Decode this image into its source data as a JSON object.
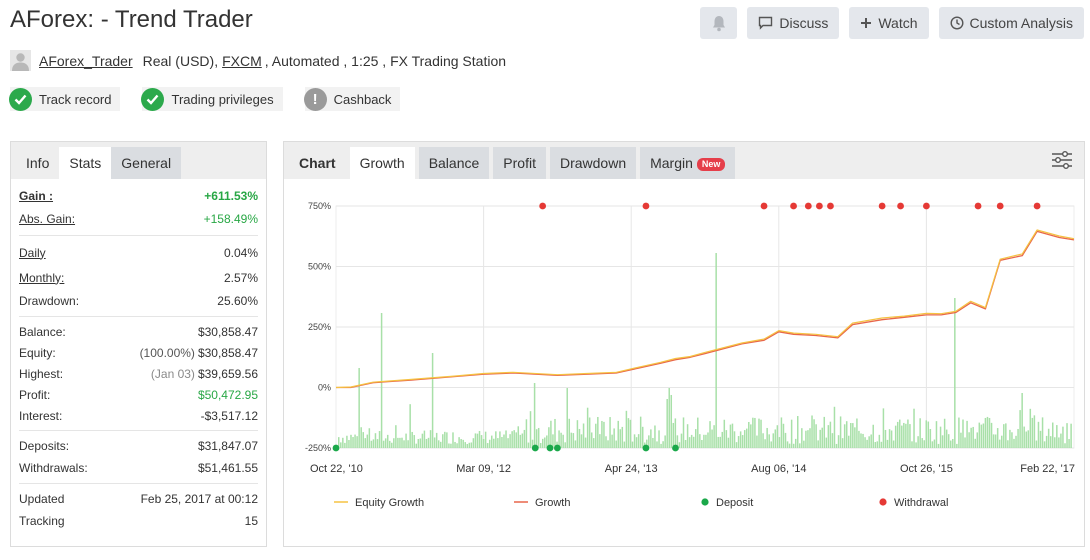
{
  "header": {
    "title": "AForex: - Trend Trader",
    "buttons": {
      "discuss": "Discuss",
      "watch": "Watch",
      "custom_analysis": "Custom Analysis"
    }
  },
  "account": {
    "trader": "AForex_Trader",
    "type": "Real (USD),",
    "broker": "FXCM",
    "details": ", Automated , 1:25 , FX Trading Station"
  },
  "badges": {
    "track_record": "Track record",
    "trading_privileges": "Trading privileges",
    "cashback": "Cashback"
  },
  "stats_tabs": {
    "info": "Info",
    "stats": "Stats",
    "general": "General"
  },
  "stats": {
    "gain": {
      "label": "Gain :",
      "value": "+611.53%"
    },
    "abs_gain": {
      "label": "Abs. Gain:",
      "value": "+158.49%"
    },
    "daily": {
      "label": "Daily",
      "value": "0.04%"
    },
    "monthly": {
      "label": "Monthly:",
      "value": "2.57%"
    },
    "drawdown": {
      "label": "Drawdown:",
      "value": "25.60%"
    },
    "balance": {
      "label": "Balance:",
      "value": "$30,858.47"
    },
    "equity": {
      "label": "Equity:",
      "note": "(100.00%)",
      "value": "$30,858.47"
    },
    "highest": {
      "label": "Highest:",
      "note": "(Jan 03)",
      "value": "$39,659.56"
    },
    "profit": {
      "label": "Profit:",
      "value": "$50,472.95"
    },
    "interest": {
      "label": "Interest:",
      "value": "-$3,517.12"
    },
    "deposits": {
      "label": "Deposits:",
      "value": "$31,847.07"
    },
    "withdrawals": {
      "label": "Withdrawals:",
      "value": "$51,461.55"
    },
    "updated": {
      "label": "Updated",
      "value": "Feb 25, 2017 at 00:12"
    },
    "tracking": {
      "label": "Tracking",
      "value": "15"
    }
  },
  "chart_tabs": {
    "chart": "Chart",
    "growth": "Growth",
    "balance": "Balance",
    "profit": "Profit",
    "drawdown": "Drawdown",
    "margin": "Margin",
    "new_badge": "New"
  },
  "colors": {
    "equity": "#f5c242",
    "growth": "#e8664a",
    "deposit": "#1aa84a",
    "withdrawal": "#e53935",
    "volume": "#a8e0a8"
  },
  "chart_data": {
    "type": "line",
    "yticks": [
      "750%",
      "500%",
      "250%",
      "0%",
      "-250%"
    ],
    "ytick_values": [
      750,
      500,
      250,
      0,
      -250
    ],
    "ylim": [
      -250,
      750
    ],
    "xticks": [
      "Oct 22, '10",
      "Mar 09, '12",
      "Apr 24, '13",
      "Aug 06, '14",
      "Oct 26, '15",
      "Feb 22, '17"
    ],
    "xlim": [
      0,
      1
    ],
    "legend": [
      "Equity Growth",
      "Growth",
      "Deposit",
      "Withdrawal"
    ],
    "legend_position": "bottom",
    "series": [
      {
        "name": "Growth",
        "x": [
          0,
          0.02,
          0.05,
          0.1,
          0.16,
          0.2,
          0.24,
          0.3,
          0.34,
          0.38,
          0.41,
          0.44,
          0.46,
          0.48,
          0.5,
          0.55,
          0.58,
          0.6,
          0.62,
          0.65,
          0.68,
          0.7,
          0.74,
          0.77,
          0.8,
          0.82,
          0.84,
          0.86,
          0.88,
          0.9,
          0.93,
          0.95,
          0.98,
          1.0
        ],
        "values": [
          0,
          0,
          20,
          30,
          45,
          55,
          60,
          50,
          55,
          60,
          80,
          100,
          115,
          125,
          140,
          180,
          195,
          230,
          220,
          215,
          205,
          260,
          280,
          290,
          300,
          300,
          310,
          350,
          325,
          525,
          545,
          645,
          620,
          610
        ]
      },
      {
        "name": "Equity Growth",
        "x": [
          0,
          0.02,
          0.05,
          0.1,
          0.16,
          0.2,
          0.24,
          0.3,
          0.34,
          0.38,
          0.41,
          0.44,
          0.46,
          0.48,
          0.5,
          0.55,
          0.58,
          0.6,
          0.62,
          0.65,
          0.68,
          0.7,
          0.74,
          0.77,
          0.8,
          0.82,
          0.84,
          0.86,
          0.88,
          0.9,
          0.93,
          0.95,
          0.98,
          1.0
        ],
        "values": [
          0,
          2,
          22,
          33,
          47,
          58,
          63,
          53,
          58,
          63,
          84,
          104,
          120,
          128,
          145,
          184,
          200,
          235,
          225,
          220,
          210,
          266,
          287,
          295,
          306,
          305,
          315,
          356,
          330,
          530,
          552,
          651,
          626,
          615
        ]
      }
    ],
    "deposits_x": [
      0,
      0.27,
      0.29,
      0.3,
      0.42,
      0.46
    ],
    "withdrawals_x": [
      0.28,
      0.42,
      0.58,
      0.62,
      0.64,
      0.655,
      0.67,
      0.74,
      0.765,
      0.8,
      0.87,
      0.9,
      0.95
    ]
  }
}
